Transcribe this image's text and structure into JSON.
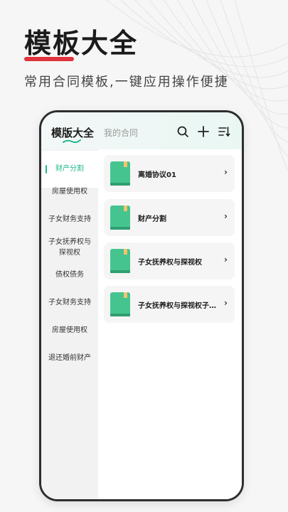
{
  "hero": {
    "title": "模板大全",
    "subtitle": "常用合同模板,一键应用操作便捷"
  },
  "colors": {
    "accent_red": "#e0333b",
    "accent_green": "#20b890",
    "book_green": "#45c48f",
    "bookmark": "#f1c56c"
  },
  "tabs": {
    "active": "模版大全",
    "inactive": "我的合同"
  },
  "toolbar": {
    "icons": [
      "search-icon",
      "plus-icon",
      "sort-list-icon"
    ]
  },
  "sidebar": {
    "items": [
      {
        "label": "财产分割",
        "active": true
      },
      {
        "label": "房屋使用权"
      },
      {
        "label": "子女财务支持"
      },
      {
        "label": "子女抚养权与探视权"
      },
      {
        "label": "债权债务"
      },
      {
        "label": "子女财务支持"
      },
      {
        "label": "房屋使用权"
      },
      {
        "label": "退还婚前财产"
      }
    ]
  },
  "templates": [
    {
      "label": "离婚协议01",
      "chevron": "›"
    },
    {
      "label": "财产分割",
      "chevron": "›"
    },
    {
      "label": "子女抚养权与探视权",
      "chevron": "›"
    },
    {
      "label": "子女抚养权与探视权子女抚养权与探视权",
      "chevron": "›"
    }
  ]
}
